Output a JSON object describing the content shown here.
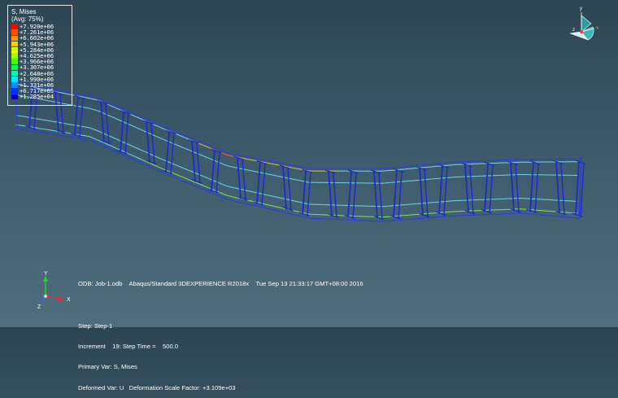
{
  "legend": {
    "title_line1": "S, Mises",
    "title_line2": "(Avg: 75%)",
    "entries": [
      {
        "value": "+7.920e+06",
        "color": "#ff0000"
      },
      {
        "value": "+7.261e+06",
        "color": "#ff4d00"
      },
      {
        "value": "+6.602e+06",
        "color": "#ff9900"
      },
      {
        "value": "+5.943e+06",
        "color": "#ffd000"
      },
      {
        "value": "+5.284e+06",
        "color": "#e8ff00"
      },
      {
        "value": "+4.625e+06",
        "color": "#a0ff00"
      },
      {
        "value": "+3.966e+06",
        "color": "#40ff00"
      },
      {
        "value": "+3.307e+06",
        "color": "#00ff50"
      },
      {
        "value": "+2.648e+06",
        "color": "#00ffb0"
      },
      {
        "value": "+1.990e+06",
        "color": "#00e8ff"
      },
      {
        "value": "+1.331e+06",
        "color": "#0090ff"
      },
      {
        "value": "+6.717e+05",
        "color": "#0030ff"
      },
      {
        "value": "+1.285e+04",
        "color": "#0000c8"
      }
    ]
  },
  "info": {
    "odb": "ODB: Job-1.odb    Abaqus/Standard 3DEXPERIENCE R2018x    Tue Sep 13 21:33:17 GMT+08:00 2016",
    "step": "Step: Step-1",
    "increment": "Increment    19: Step Time =    500.0",
    "primary_var": "Primary Var: S, Mises",
    "deformed_var": "Deformed Var: U   Deformation Scale Factor: +3.109e+03"
  },
  "triad": {
    "x": "X",
    "y": "Y",
    "z": "Z"
  },
  "orient": {
    "x": "x",
    "y": "y",
    "z": "z"
  },
  "colors": {
    "background_top": "#2d4553",
    "background_bottom": "#4e6e7e",
    "mesh": "#1a2ad0"
  }
}
